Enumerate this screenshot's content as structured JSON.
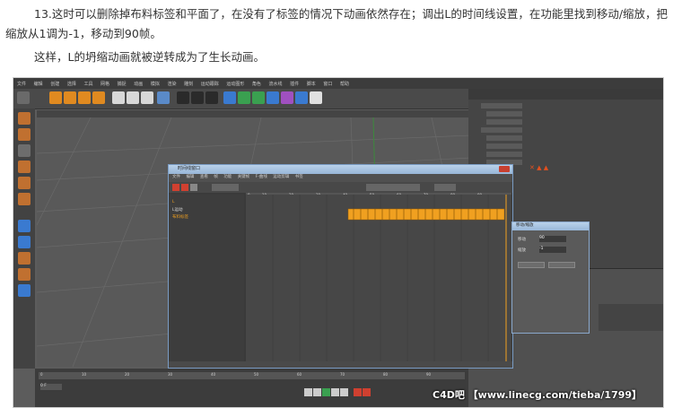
{
  "article": {
    "para1": "13.这时可以删除掉布料标签和平面了，在没有了标签的情况下动画依然存在；调出L的时间线设置，在功能里找到移动/缩放，把",
    "para2": "缩放从1调为-1，移动到90帧。",
    "para3": "这样，L的坍缩动画就被逆转成为了生长动画。"
  },
  "screenshot": {
    "menu_items": [
      "文件",
      "编辑",
      "创建",
      "选择",
      "工具",
      "网格",
      "捕捉",
      "动画",
      "模拟",
      "渲染",
      "雕刻",
      "运动跟踪",
      "运动图形",
      "角色",
      "流水线",
      "插件",
      "脚本",
      "窗口",
      "帮助"
    ],
    "timeline_window_title": "时间线窗口",
    "timeline_menu": [
      "文件",
      "编辑",
      "查看",
      "帧",
      "功能",
      "关键帧",
      "F-曲线",
      "运动剪辑",
      "书签"
    ],
    "timeline_ruler": [
      "0",
      "10",
      "20",
      "30",
      "40",
      "50",
      "60",
      "70",
      "80",
      "90"
    ],
    "tracks": [
      "L",
      "L运动",
      "布料标签"
    ],
    "dialog_title": "移动/缩放",
    "dialog_fields": [
      "移动",
      "缩放",
      "1",
      "-1",
      "90"
    ],
    "bottom_ruler": [
      "0",
      "10",
      "20",
      "30",
      "40",
      "50",
      "60",
      "70",
      "80",
      "90"
    ],
    "frame_value": "0 F",
    "accent_colors": {
      "keyframe": "#f0a020",
      "titlebar": "#98b6d8",
      "ui_dark": "#3c3c3c"
    }
  },
  "watermark": "C4D吧 【www.linecg.com/tieba/1799】"
}
